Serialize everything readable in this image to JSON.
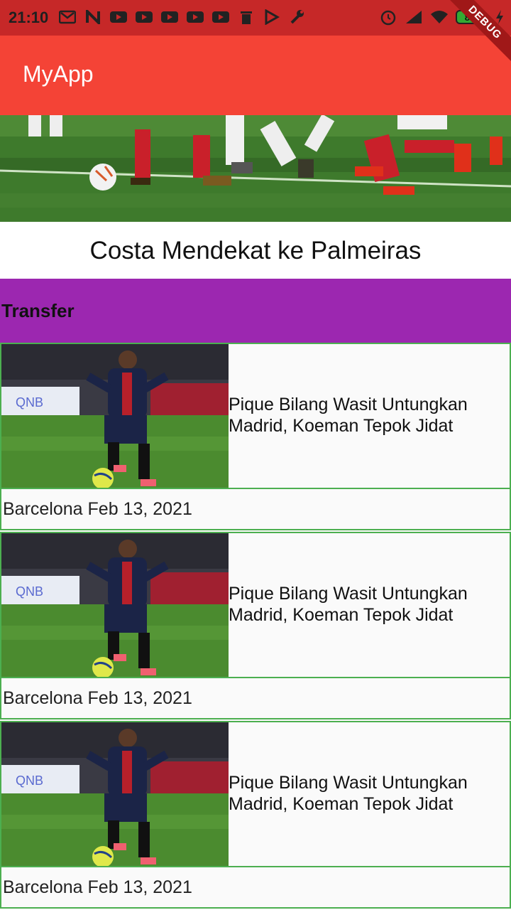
{
  "status_bar": {
    "time": "21:10",
    "battery": "80",
    "left_icons": [
      "mail-icon",
      "n-icon",
      "youtube-icon",
      "youtube-icon",
      "youtube-icon",
      "youtube-icon",
      "youtube-icon",
      "trash-icon",
      "play-store-icon",
      "wrench-icon"
    ],
    "right_icons": [
      "alarm-icon",
      "signal-icon",
      "wifi-icon",
      "battery-icon",
      "charging-icon"
    ]
  },
  "debug_banner": "DEBUG",
  "app_bar": {
    "title": "MyApp"
  },
  "hero": {
    "headline": "Costa Mendekat ke Palmeiras"
  },
  "section": {
    "title": "Transfer"
  },
  "articles": [
    {
      "title": "Pique Bilang Wasit Untungkan Madrid, Koeman  Tepok Jidat",
      "category": "Barcelona",
      "date": "Feb 13, 2021",
      "meta": "Barcelona Feb 13, 2021"
    },
    {
      "title": "Pique Bilang Wasit Untungkan Madrid, Koeman  Tepok Jidat",
      "category": "Barcelona",
      "date": "Feb 13, 2021",
      "meta": "Barcelona Feb 13, 2021"
    },
    {
      "title": "Pique Bilang Wasit Untungkan Madrid, Koeman  Tepok Jidat",
      "category": "Barcelona",
      "date": "Feb 13, 2021",
      "meta": "Barcelona Feb 13, 2021"
    }
  ],
  "colors": {
    "status_bar": "#c62828",
    "app_bar": "#f44336",
    "section_bar": "#9c27b0",
    "card_border": "#4caf50"
  }
}
